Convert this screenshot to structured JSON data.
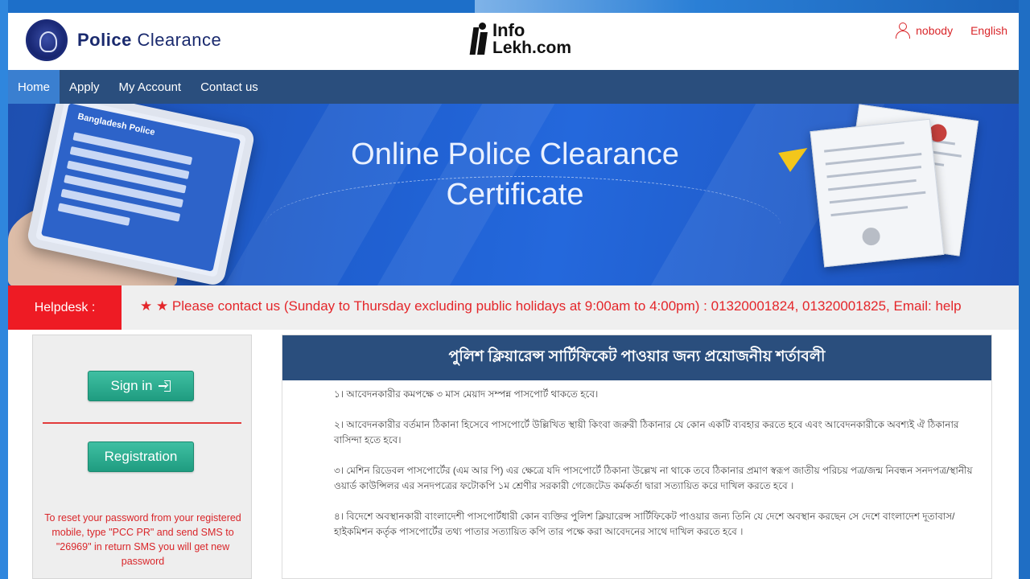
{
  "header": {
    "title_bold": "Police",
    "title_rest": "Clearance",
    "watermark_line1": "Info",
    "watermark_line2": "Lekh.com",
    "user_label": "nobody",
    "language": "English"
  },
  "nav": {
    "items": [
      {
        "label": "Home",
        "active": true
      },
      {
        "label": "Apply"
      },
      {
        "label": "My Account"
      },
      {
        "label": "Contact us"
      }
    ]
  },
  "banner": {
    "title_line1": "Online Police Clearance",
    "title_line2": "Certificate",
    "tablet_label": "Bangladesh Police"
  },
  "helpdesk": {
    "label": "Helpdesk :",
    "message": "★ ★ Please contact us (Sunday to Thursday excluding public holidays at 9:00am to 4:00pm) : 01320001824, 01320001825, Email: help"
  },
  "sidebar": {
    "signin_label": "Sign in",
    "registration_label": "Registration",
    "reset_info": "To reset your password from your registered mobile, type \"PCC PR\" and send SMS to \"26969\" in return SMS you will get new password"
  },
  "requirements": {
    "heading": "পুলিশ ক্লিয়ারেন্স সার্টিফিকেট পাওয়ার জন্য প্রয়োজনীয় শর্তাবলী",
    "items": [
      "১। আবেদনকারীর কমপক্ষে ৩ মাস মেয়াদ সম্পন্ন পাসপোর্ট থাকতে হবে।",
      "২। আবেদনকারীর বর্তমান ঠিকানা হিসেবে পাসপোর্টে উল্লিখিত স্থায়ী কিংবা জরুরী ঠিকানার যে কোন একটি ব্যবহার করতে হবে এবং আবেদনকারীকে অবশ্যই ঐ ঠিকানার বাসিন্দা হতে হবে।",
      "৩। মেশিন রিডেবল পাসপোর্টের (এম আর পি) এর ক্ষেত্রে যদি পাসপোর্টে ঠিকানা উল্লেখ না থাকে তবে ঠিকানার প্রমাণ স্বরূপ জাতীয় পরিচয় পত্র/জন্ম নিবন্ধন সনদপত্র/স্থানীয় ওয়ার্ড কাউন্সিলর এর সনদপত্রের ফটোকপি ১ম শ্রেণীর সরকারী গেজেটেড কর্মকর্তা দ্বারা সত্যায়িত করে দাখিল করতে হবে ।",
      "৪। বিদেশে অবস্থানকারী বাংলাদেশী পাসপোর্টধারী কোন ব্যক্তির পুলিশ ক্লিয়ারেন্স সার্টিফিকেট পাওয়ার জন্য তিনি যে দেশে অবস্থান করছেন সে দেশে বাংলাদেশ দূতাবাস/ হাইকমিশন কর্তৃক পাসপোর্টের তথ্য পাতার সত্যায়িত কপি তার পক্ষে করা আবেদনের সাথে দাখিল করতে হবে ।"
    ]
  },
  "colors": {
    "nav_bg": "#2a4e7d",
    "nav_active": "#3a7fd0",
    "helpdesk_red": "#ee1b24",
    "button_green": "#2bab8e",
    "accent_red": "#d9262a"
  }
}
